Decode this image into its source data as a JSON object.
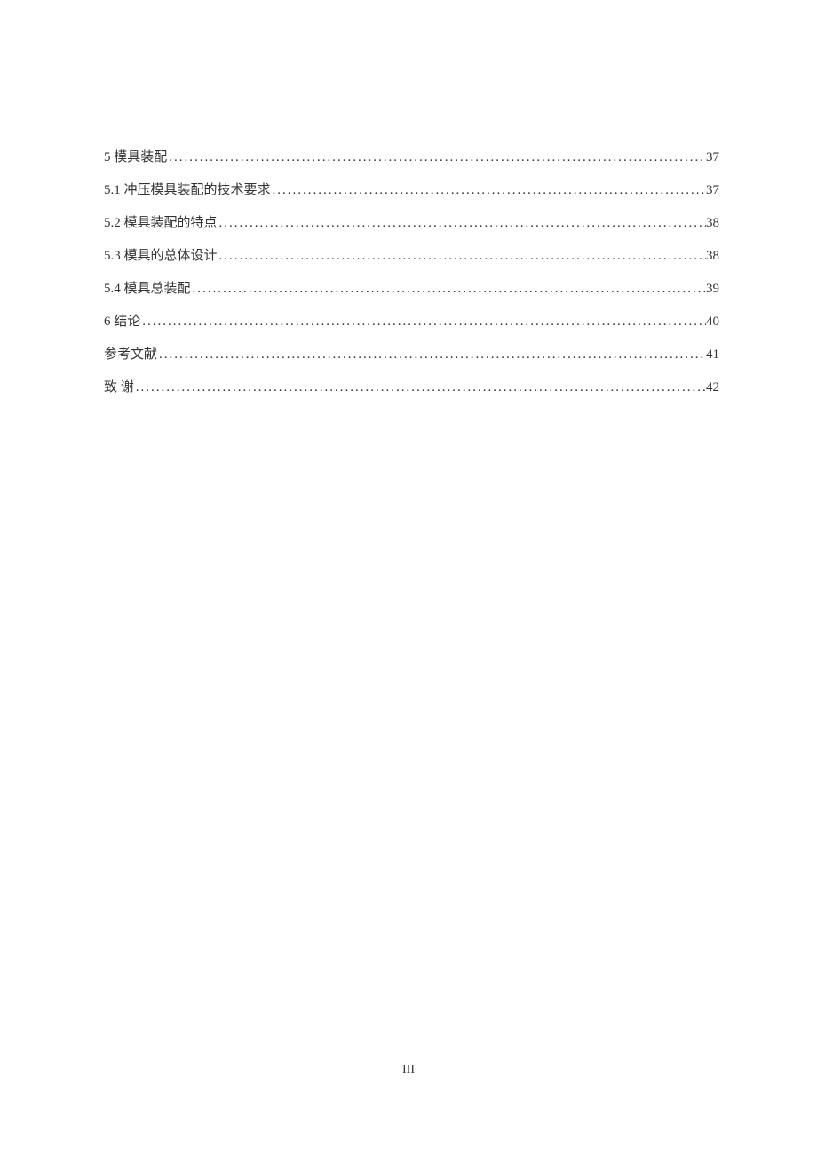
{
  "toc": {
    "entries": [
      {
        "title": "5  模具装配",
        "page": "37"
      },
      {
        "title": "5.1 冲压模具装配的技术要求",
        "page": "37"
      },
      {
        "title": "5.2 模具装配的特点",
        "page": "38"
      },
      {
        "title": "5.3 模具的总体设计",
        "page": "38"
      },
      {
        "title": "5.4 模具总装配",
        "page": "39"
      },
      {
        "title": "6 结论",
        "page": "40"
      },
      {
        "title": "参考文献",
        "page": "41"
      },
      {
        "title": "致 谢",
        "page": "42"
      }
    ]
  },
  "pageNumber": "III"
}
